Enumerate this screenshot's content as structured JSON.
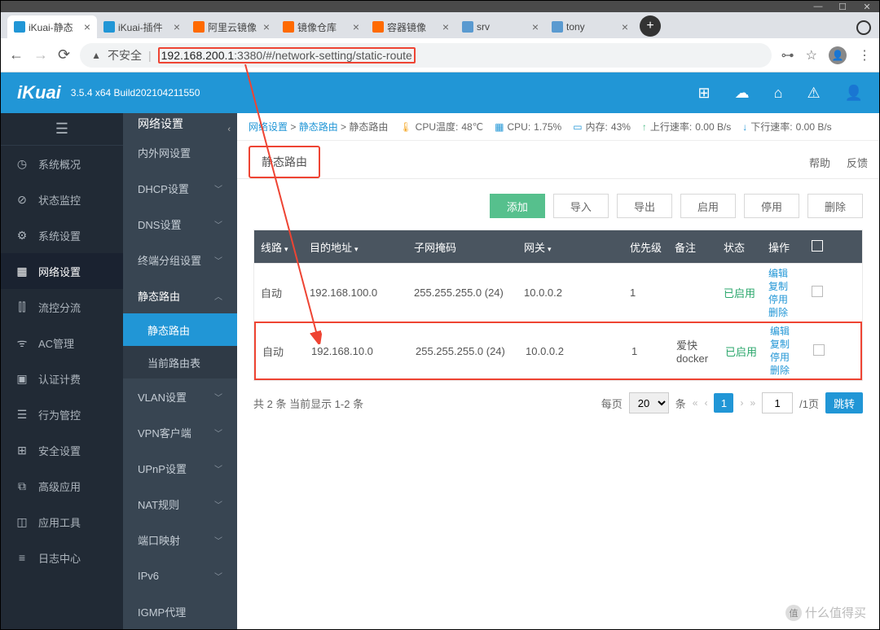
{
  "browser": {
    "tabs": [
      {
        "title": "iKuai-静态",
        "favicon": "#2196d6"
      },
      {
        "title": "iKuai-插件",
        "favicon": "#2196d6"
      },
      {
        "title": "阿里云镜像",
        "favicon": "#ff6a00"
      },
      {
        "title": "镜像仓库",
        "favicon": "#ff6a00"
      },
      {
        "title": "容器镜像",
        "favicon": "#ff6a00"
      },
      {
        "title": "srv",
        "favicon": "#5a9ad0"
      },
      {
        "title": "tony",
        "favicon": "#5a9ad0"
      }
    ],
    "insecure": "不安全",
    "url_host": "192.168.200.1",
    "url_path": ":3380/#/network-setting/static-route"
  },
  "header": {
    "logo": "iKuai",
    "build": "3.5.4 x64 Build202104211550"
  },
  "nav1": [
    {
      "icon": "◷",
      "label": "系统概况"
    },
    {
      "icon": "⊘",
      "label": "状态监控"
    },
    {
      "icon": "⚙",
      "label": "系统设置"
    },
    {
      "icon": "▦",
      "label": "网络设置",
      "active": true
    },
    {
      "icon": "⫿⫿",
      "label": "流控分流"
    },
    {
      "icon": "ᯤ",
      "label": "AC管理"
    },
    {
      "icon": "▣",
      "label": "认证计费"
    },
    {
      "icon": "☰",
      "label": "行为管控"
    },
    {
      "icon": "⊞",
      "label": "安全设置"
    },
    {
      "icon": "⧉",
      "label": "高级应用"
    },
    {
      "icon": "◫",
      "label": "应用工具"
    },
    {
      "icon": "≡",
      "label": "日志中心"
    }
  ],
  "nav2": {
    "title": "网络设置",
    "items": [
      {
        "label": "内外网设置"
      },
      {
        "label": "DHCP设置",
        "expandable": true
      },
      {
        "label": "DNS设置",
        "expandable": true
      },
      {
        "label": "终端分组设置",
        "expandable": true
      },
      {
        "label": "静态路由",
        "expandable": true,
        "open": true,
        "children": [
          {
            "label": "静态路由",
            "active": true
          },
          {
            "label": "当前路由表"
          }
        ]
      },
      {
        "label": "VLAN设置",
        "expandable": true
      },
      {
        "label": "VPN客户端",
        "expandable": true
      },
      {
        "label": "UPnP设置",
        "expandable": true
      },
      {
        "label": "NAT规则",
        "expandable": true
      },
      {
        "label": "端口映射",
        "expandable": true
      },
      {
        "label": "IPv6",
        "expandable": true
      },
      {
        "label": "IGMP代理"
      }
    ]
  },
  "crumb": {
    "p1": "网络设置",
    "p2": "静态路由",
    "p3": "静态路由",
    "cpu_temp_label": "CPU温度:",
    "cpu_temp": "48℃",
    "cpu_label": "CPU:",
    "cpu": "1.75%",
    "mem_label": "内存:",
    "mem": "43%",
    "up_label": "上行速率:",
    "up": "0.00 B/s",
    "down_label": "下行速率:",
    "down": "0.00 B/s"
  },
  "page": {
    "tab": "静态路由",
    "help": "帮助",
    "feedback": "反馈"
  },
  "toolbar": {
    "add": "添加",
    "import": "导入",
    "export": "导出",
    "enable": "启用",
    "disable": "停用",
    "delete": "删除"
  },
  "columns": {
    "line": "线路",
    "dest": "目的地址",
    "mask": "子网掩码",
    "gw": "网关",
    "pri": "优先级",
    "note": "备注",
    "stat": "状态",
    "ops": "操作"
  },
  "rows": [
    {
      "line": "自动",
      "dest": "192.168.100.0",
      "mask": "255.255.255.0 (24)",
      "gw": "10.0.0.2",
      "pri": "1",
      "note": "",
      "stat": "已启用"
    },
    {
      "line": "自动",
      "dest": "192.168.10.0",
      "mask": "255.255.255.0 (24)",
      "gw": "10.0.0.2",
      "pri": "1",
      "note": "爱快docker",
      "stat": "已启用",
      "hl": true
    }
  ],
  "row_ops": {
    "edit": "编辑",
    "copy": "复制",
    "disable": "停用",
    "delete": "删除"
  },
  "pager": {
    "summary": "共 2 条 当前显示 1-2 条",
    "perpage_label": "每页",
    "perpage": "20",
    "unit": "条",
    "page": "1",
    "total": "/1页",
    "go": "跳转"
  },
  "watermark": "什么值得买"
}
